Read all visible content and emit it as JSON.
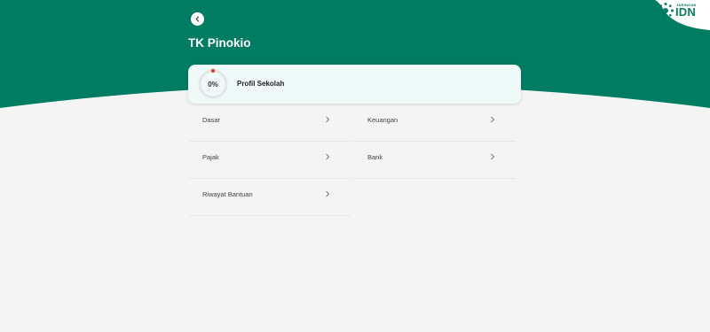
{
  "header": {
    "title": "TK Pinokio",
    "back_icon": "chevron-left-icon",
    "bg_color": "#007c63"
  },
  "logo": {
    "sup": "JARINGAN",
    "main": "IDN",
    "mark_icon": "sun-dots-icon",
    "color": "#0b7b63"
  },
  "profile": {
    "progress_label": "0%",
    "progress_value": 0,
    "label": "Profil Sekolah",
    "status_color": "#d64537"
  },
  "menu": {
    "items": [
      {
        "label": "Dasar"
      },
      {
        "label": "Keuangan"
      },
      {
        "label": "Pajak"
      },
      {
        "label": "Bank"
      },
      {
        "label": "Riwayat Bantuan"
      }
    ]
  }
}
